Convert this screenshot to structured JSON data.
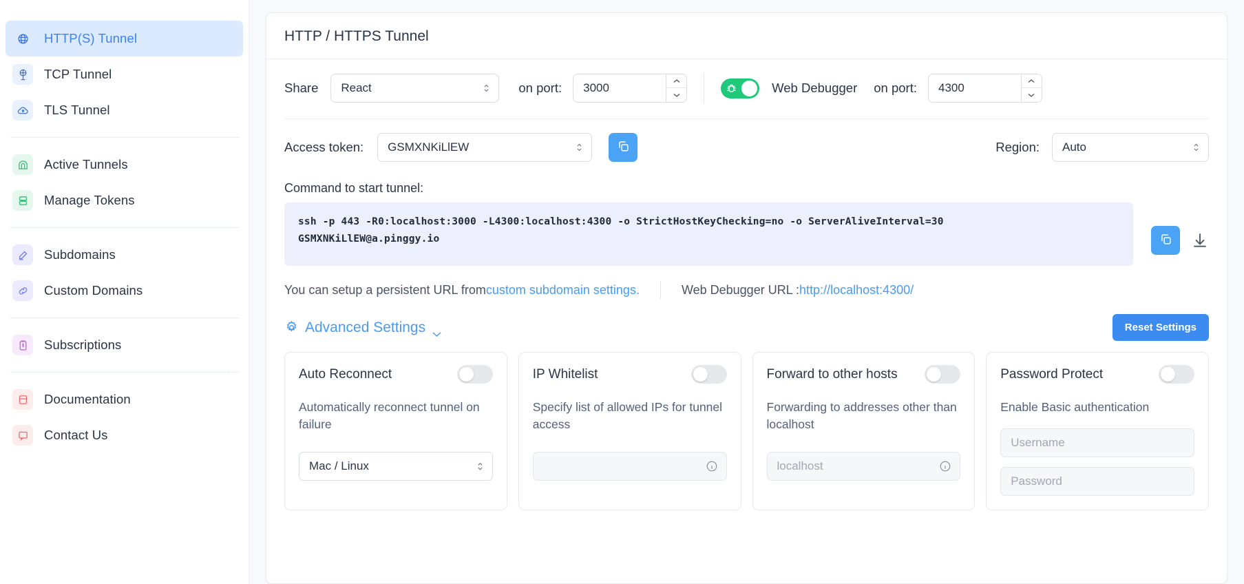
{
  "sidebar": {
    "groups": [
      {
        "items": [
          {
            "label": "HTTP(S) Tunnel",
            "icon": "globe-icon",
            "active": true
          },
          {
            "label": "TCP Tunnel",
            "icon": "tcp-globe-icon",
            "active": false
          },
          {
            "label": "TLS Tunnel",
            "icon": "cloud-lock-icon",
            "active": false
          }
        ]
      },
      {
        "items": [
          {
            "label": "Active Tunnels",
            "icon": "tunnel-icon",
            "active": false
          },
          {
            "label": "Manage Tokens",
            "icon": "tokens-icon",
            "active": false
          }
        ]
      },
      {
        "items": [
          {
            "label": "Subdomains",
            "icon": "pencil-square-icon",
            "active": false
          },
          {
            "label": "Custom Domains",
            "icon": "link-icon",
            "active": false
          }
        ]
      },
      {
        "items": [
          {
            "label": "Subscriptions",
            "icon": "receipt-icon",
            "active": false
          }
        ]
      },
      {
        "items": [
          {
            "label": "Documentation",
            "icon": "book-icon",
            "active": false
          },
          {
            "label": "Contact Us",
            "icon": "chat-icon",
            "active": false
          }
        ]
      }
    ]
  },
  "panel": {
    "title": "HTTP / HTTPS Tunnel",
    "share": {
      "label": "Share",
      "value": "React",
      "port_label": "on port:",
      "port_value": "3000"
    },
    "debugger": {
      "toggle_on": true,
      "toggle_icon": "bug-icon",
      "label": "Web Debugger",
      "port_label": "on port:",
      "port_value": "4300"
    },
    "token": {
      "label": "Access token:",
      "value": "GSMXNKiLlEW",
      "copy_icon": "copy-icon"
    },
    "region": {
      "label": "Region:",
      "value": "Auto"
    },
    "command": {
      "label": "Command to start tunnel:",
      "line1": "ssh -p 443 -R0:localhost:3000 -L4300:localhost:4300 -o StrictHostKeyChecking=no -o ServerAliveInterval=30",
      "line2": "GSMXNKiLlEW@a.pinggy.io",
      "copy_icon": "copy-icon",
      "download_icon": "download-icon"
    },
    "links": {
      "persistent_prefix": "You can setup a persistent URL from ",
      "persistent_link": "custom subdomain settings.",
      "debugger_label": "Web Debugger URL : ",
      "debugger_url": "http://localhost:4300/"
    },
    "advanced": {
      "link_label": "Advanced Settings",
      "gear_icon": "gear-icon",
      "chevron_icon": "chevron-down-icon",
      "reset_label": "Reset Settings"
    },
    "cards": [
      {
        "title": "Auto Reconnect",
        "toggle_on": false,
        "desc": "Automatically reconnect tunnel on failure",
        "field_kind": "select",
        "field_value": "Mac / Linux"
      },
      {
        "title": "IP Whitelist",
        "toggle_on": false,
        "desc": "Specify list of allowed IPs for tunnel access",
        "field_kind": "input-info",
        "field_placeholder": ""
      },
      {
        "title": "Forward to other hosts",
        "toggle_on": false,
        "desc": "Forwarding to addresses other than localhost",
        "field_kind": "input-info",
        "field_placeholder": "localhost"
      },
      {
        "title": "Password Protect",
        "toggle_on": false,
        "desc": "Enable Basic authentication",
        "field_kind": "two-inputs",
        "field_placeholder": "Username",
        "field2_placeholder": "Password"
      }
    ]
  },
  "colors": {
    "accent": "#3b8bf0",
    "toggle_on": "#1fc979",
    "link": "#4a9bf0",
    "code_bg": "#edf0fc"
  }
}
